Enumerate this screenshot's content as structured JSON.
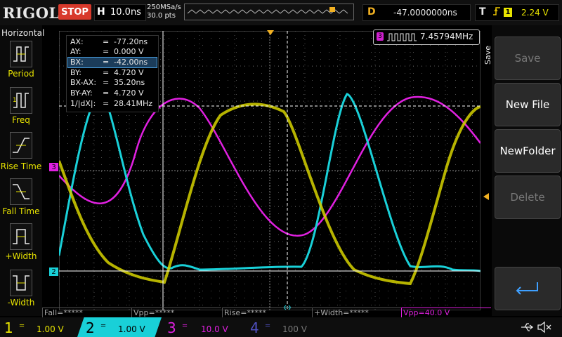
{
  "brand": "RIGOL",
  "run_state": "STOP",
  "timebase": {
    "label": "H",
    "value": "10.0ns"
  },
  "sample_rate": {
    "rate": "250MSa/s",
    "points": "30.0 pts"
  },
  "delay": {
    "label": "D",
    "value": "-47.0000000ns"
  },
  "trigger": {
    "label": "T",
    "edge_icon": "rising-edge-icon",
    "source": "1",
    "level": "2.24 V"
  },
  "left_menu": {
    "title": "Horizontal",
    "items": [
      "Period",
      "Freq",
      "Rise Time",
      "Fall Time",
      "+Width",
      "-Width"
    ]
  },
  "right_menu": {
    "title": "Save",
    "items": [
      "Save",
      "New File",
      "NewFolder",
      "Delete"
    ],
    "return_icon": "return-arrow-icon"
  },
  "cursor_table": [
    {
      "key": "AX:",
      "value": "-77.20ns"
    },
    {
      "key": "AY:",
      "value": "0.000 V"
    },
    {
      "key": "BX:",
      "value": "-42.00ns"
    },
    {
      "key": "BY:",
      "value": "4.720 V"
    },
    {
      "key": "BX-AX:",
      "value": "35.20ns"
    },
    {
      "key": "BY-AY:",
      "value": "4.720 V"
    },
    {
      "key": "1/|dX|:",
      "value": "28.41MHz"
    }
  ],
  "freq_counter": {
    "channel": "3",
    "value": "7.45794MHz"
  },
  "markers": {
    "ch3": "3",
    "ch2": "2"
  },
  "measurements": [
    "Fall=*****",
    "Vpp=*****",
    "Rise=*****",
    "+Width=*****",
    "Vpp=40.0 V"
  ],
  "channels": [
    {
      "num": "1",
      "scale": "1.00 V",
      "color": "#e8e400"
    },
    {
      "num": "2",
      "scale": "1.00 V",
      "color": "#19d0d8"
    },
    {
      "num": "3",
      "scale": "10.0 V",
      "color": "#e020e0"
    },
    {
      "num": "4",
      "scale": "100 V",
      "color": "#5050c0"
    }
  ],
  "status_icons": [
    "usb-icon",
    "speaker-muted-icon"
  ],
  "colors": {
    "ch1": "#e8e400",
    "ch2": "#19d0d8",
    "ch3": "#e020e0",
    "accent": "#f2b122",
    "stop": "#d8392b"
  }
}
